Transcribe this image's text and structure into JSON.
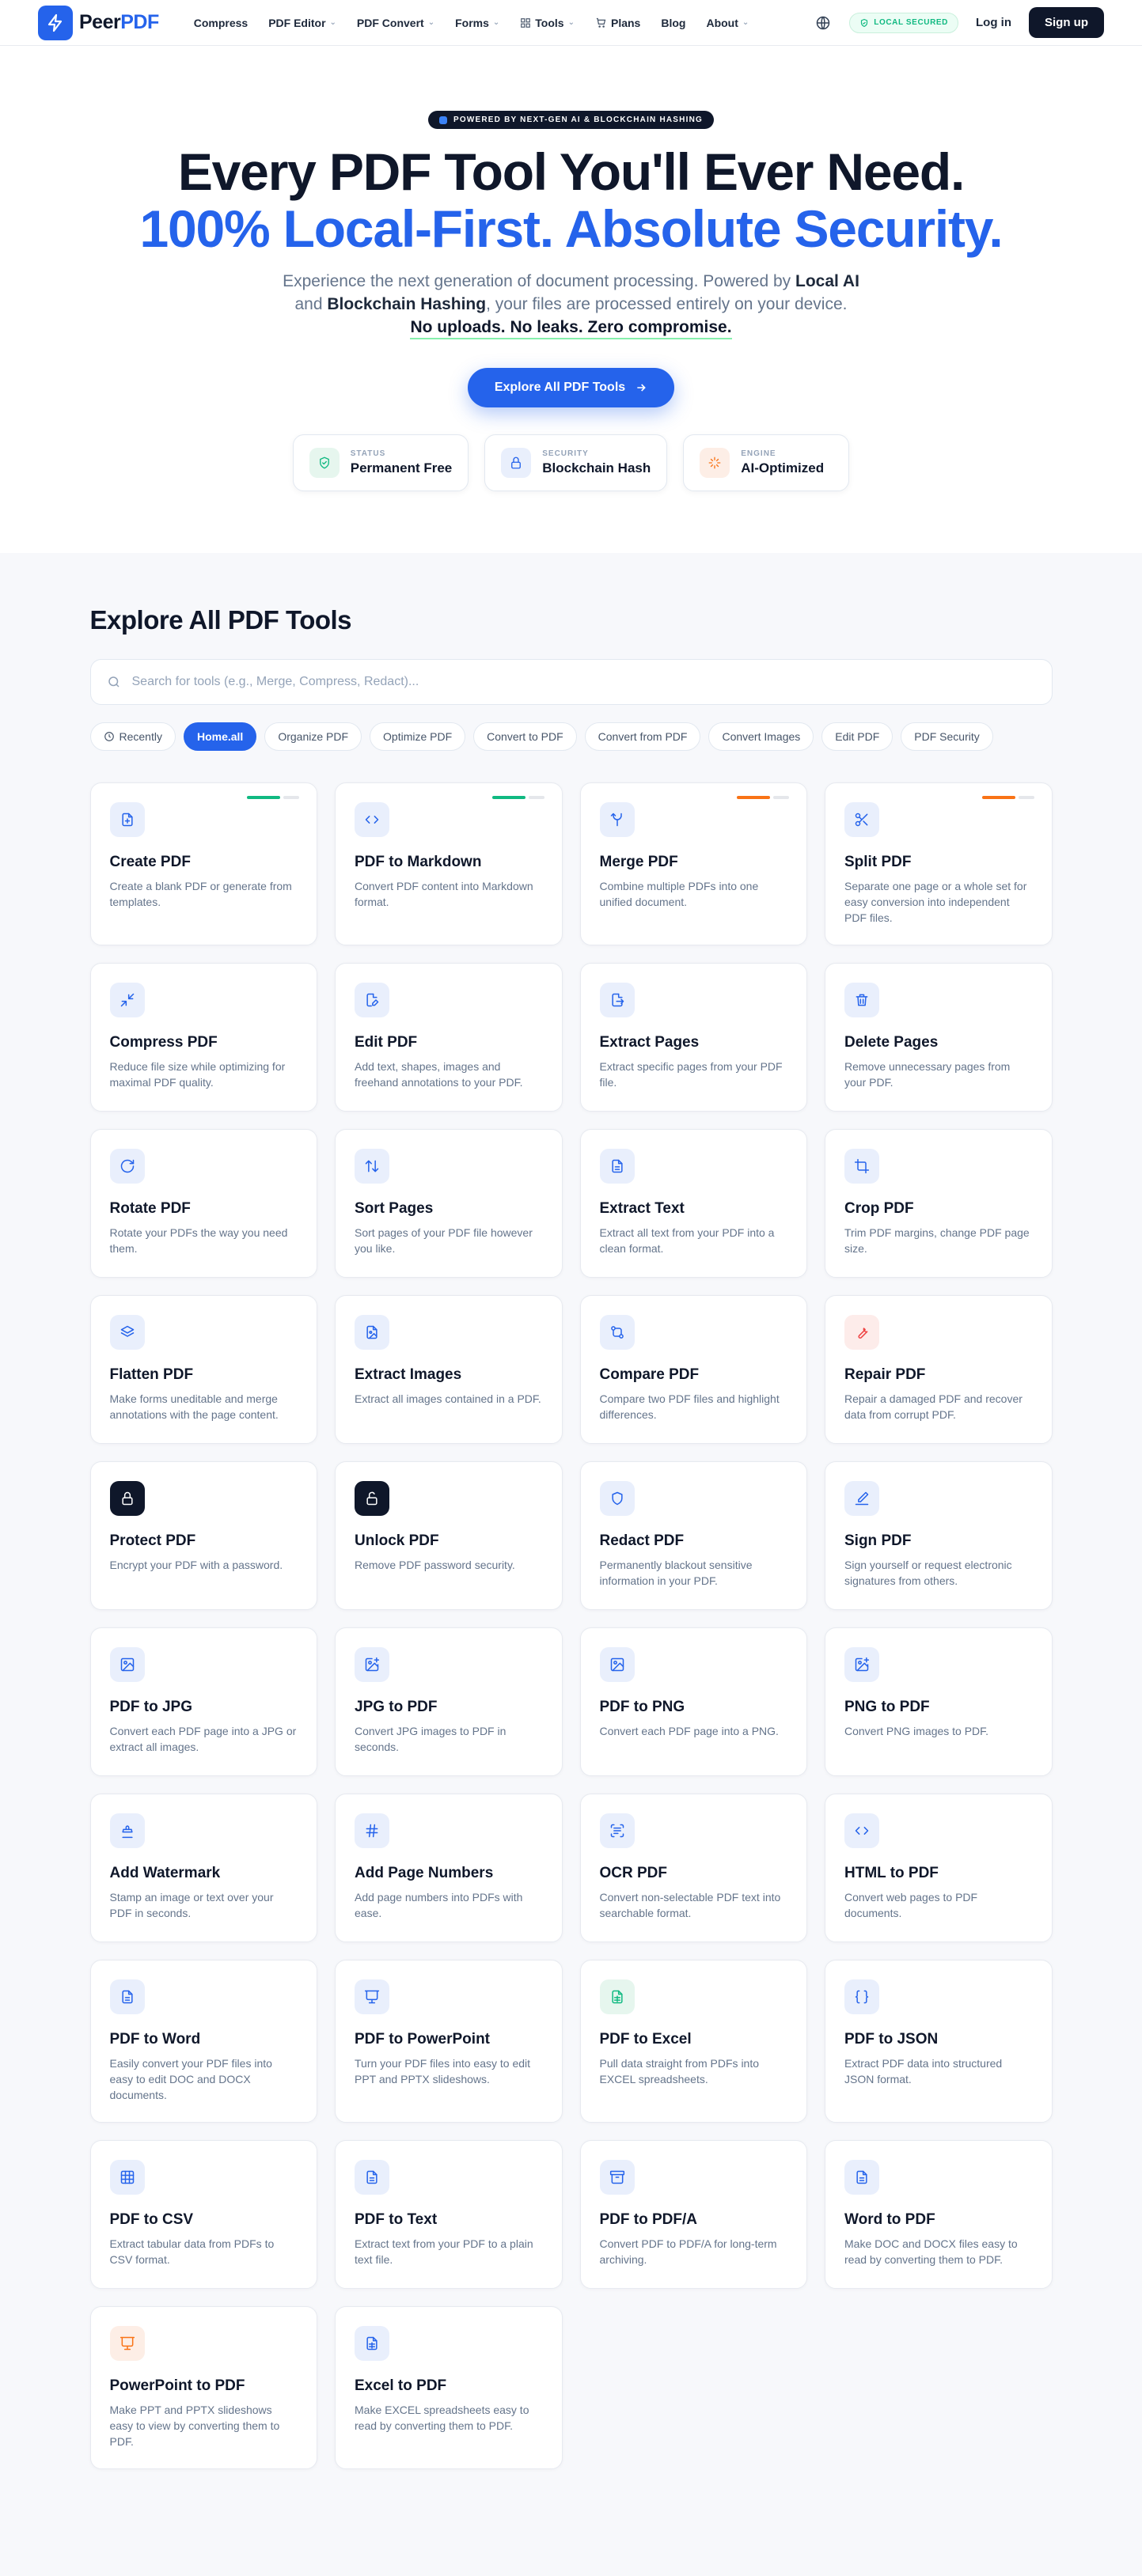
{
  "nav": {
    "brand_a": "Peer",
    "brand_b": "PDF",
    "links": [
      {
        "label": "Compress",
        "dropdown": false
      },
      {
        "label": "PDF Editor",
        "dropdown": true
      },
      {
        "label": "PDF Convert",
        "dropdown": true
      },
      {
        "label": "Forms",
        "dropdown": true
      },
      {
        "label": "Tools",
        "dropdown": true
      },
      {
        "label": "Plans",
        "dropdown": false
      },
      {
        "label": "Blog",
        "dropdown": false
      },
      {
        "label": "About",
        "dropdown": true
      }
    ],
    "local_badge": "LOCAL SECURED",
    "login": "Log in",
    "signup": "Sign up"
  },
  "hero": {
    "pill": "POWERED BY NEXT-GEN AI & BLOCKCHAIN HASHING",
    "title_line1": "Every PDF Tool You'll Ever Need.",
    "title_line2": "100% Local-First. Absolute Security.",
    "sub_a": "Experience the next generation of document processing. Powered by ",
    "sub_b": "Local AI",
    "sub_c": "and ",
    "sub_d": "Blockchain Hashing",
    "sub_e": ", your files are processed entirely on your device.",
    "sub_u": "No uploads. No leaks. Zero compromise.",
    "cta": "Explore All PDF Tools",
    "features": [
      {
        "label": "STATUS",
        "value": "Permanent Free",
        "icon": "shield-check-icon",
        "color": "#10b981",
        "bg": "#e6f6ee"
      },
      {
        "label": "SECURITY",
        "value": "Blockchain Hash",
        "icon": "lock-icon",
        "color": "#2563eb",
        "bg": "#e9effc"
      },
      {
        "label": "ENGINE",
        "value": "AI-Optimized",
        "icon": "sparkle-icon",
        "color": "#f97316",
        "bg": "#fdeee6"
      }
    ]
  },
  "tools": {
    "title": "Explore All PDF Tools",
    "search_placeholder": "Search for tools (e.g., Merge, Compress, Redact)...",
    "filters": [
      "Recently",
      "Home.all",
      "Organize PDF",
      "Optimize PDF",
      "Convert to PDF",
      "Convert from PDF",
      "Convert Images",
      "Edit PDF",
      "PDF Security"
    ],
    "active_filter": "Home.all",
    "cards": [
      {
        "title": "Create PDF",
        "desc": "Create a blank PDF or generate from templates.",
        "icon": "file-plus-icon",
        "mark": "green"
      },
      {
        "title": "PDF to Markdown",
        "desc": "Convert PDF content into Markdown format.",
        "icon": "code-icon",
        "mark": "green"
      },
      {
        "title": "Merge PDF",
        "desc": "Combine multiple PDFs into one unified document.",
        "icon": "merge-icon",
        "mark": "orange"
      },
      {
        "title": "Split PDF",
        "desc": "Separate one page or a whole set for easy conversion into independent PDF files.",
        "icon": "scissors-icon",
        "mark": "orange"
      },
      {
        "title": "Compress PDF",
        "desc": "Reduce file size while optimizing for maximal PDF quality.",
        "icon": "compress-icon"
      },
      {
        "title": "Edit PDF",
        "desc": "Add text, shapes, images and freehand annotations to your PDF.",
        "icon": "file-edit-icon"
      },
      {
        "title": "Extract Pages",
        "desc": "Extract specific pages from your PDF file.",
        "icon": "file-export-icon"
      },
      {
        "title": "Delete Pages",
        "desc": "Remove unnecessary pages from your PDF.",
        "icon": "trash-icon"
      },
      {
        "title": "Rotate PDF",
        "desc": "Rotate your PDFs the way you need them.",
        "icon": "rotate-icon"
      },
      {
        "title": "Sort Pages",
        "desc": "Sort pages of your PDF file however you like.",
        "icon": "sort-icon"
      },
      {
        "title": "Extract Text",
        "desc": "Extract all text from your PDF into a clean format.",
        "icon": "file-text-icon"
      },
      {
        "title": "Crop PDF",
        "desc": "Trim PDF margins, change PDF page size.",
        "icon": "crop-icon"
      },
      {
        "title": "Flatten PDF",
        "desc": "Make forms uneditable and merge annotations with the page content.",
        "icon": "layers-icon"
      },
      {
        "title": "Extract Images",
        "desc": "Extract all images contained in a PDF.",
        "icon": "file-image-icon"
      },
      {
        "title": "Compare PDF",
        "desc": "Compare two PDF files and highlight differences.",
        "icon": "compare-icon"
      },
      {
        "title": "Repair PDF",
        "desc": "Repair a damaged PDF and recover data from corrupt PDF.",
        "icon": "wrench-icon",
        "tone": "red"
      },
      {
        "title": "Protect PDF",
        "desc": "Encrypt your PDF with a password.",
        "icon": "lock-icon",
        "tone": "dark"
      },
      {
        "title": "Unlock PDF",
        "desc": "Remove PDF password security.",
        "icon": "unlock-icon",
        "tone": "dark"
      },
      {
        "title": "Redact PDF",
        "desc": "Permanently blackout sensitive information in your PDF.",
        "icon": "shield-icon"
      },
      {
        "title": "Sign PDF",
        "desc": "Sign yourself or request electronic signatures from others.",
        "icon": "signature-icon"
      },
      {
        "title": "PDF to JPG",
        "desc": "Convert each PDF page into a JPG or extract all images.",
        "icon": "image-icon"
      },
      {
        "title": "JPG to PDF",
        "desc": "Convert JPG images to PDF in seconds.",
        "icon": "image-plus-icon"
      },
      {
        "title": "PDF to PNG",
        "desc": "Convert each PDF page into a PNG.",
        "icon": "image-icon"
      },
      {
        "title": "PNG to PDF",
        "desc": "Convert PNG images to PDF.",
        "icon": "image-plus-icon"
      },
      {
        "title": "Add Watermark",
        "desc": "Stamp an image or text over your PDF in seconds.",
        "icon": "stamp-icon"
      },
      {
        "title": "Add Page Numbers",
        "desc": "Add page numbers into PDFs with ease.",
        "icon": "hash-icon"
      },
      {
        "title": "OCR PDF",
        "desc": "Convert non-selectable PDF text into searchable format.",
        "icon": "scan-text-icon"
      },
      {
        "title": "HTML to PDF",
        "desc": "Convert web pages to PDF documents.",
        "icon": "code-icon"
      },
      {
        "title": "PDF to Word",
        "desc": "Easily convert your PDF files into easy to edit DOC and DOCX documents.",
        "icon": "file-text-icon"
      },
      {
        "title": "PDF to PowerPoint",
        "desc": "Turn your PDF files into easy to edit PPT and PPTX slideshows.",
        "icon": "presentation-icon"
      },
      {
        "title": "PDF to Excel",
        "desc": "Pull data straight from PDFs into EXCEL spreadsheets.",
        "icon": "file-spreadsheet-icon",
        "tone": "green"
      },
      {
        "title": "PDF to JSON",
        "desc": "Extract PDF data into structured JSON format.",
        "icon": "braces-icon"
      },
      {
        "title": "PDF to CSV",
        "desc": "Extract tabular data from PDFs to CSV format.",
        "icon": "table-icon"
      },
      {
        "title": "PDF to Text",
        "desc": "Extract text from your PDF to a plain text file.",
        "icon": "file-text-icon"
      },
      {
        "title": "PDF to PDF/A",
        "desc": "Convert PDF to PDF/A for long-term archiving.",
        "icon": "archive-icon"
      },
      {
        "title": "Word to PDF",
        "desc": "Make DOC and DOCX files easy to read by converting them to PDF.",
        "icon": "file-text-icon"
      },
      {
        "title": "PowerPoint to PDF",
        "desc": "Make PPT and PPTX slideshows easy to view by converting them to PDF.",
        "icon": "presentation-icon",
        "tone": "orange"
      },
      {
        "title": "Excel to PDF",
        "desc": "Make EXCEL spreadsheets easy to read by converting them to PDF.",
        "icon": "file-spreadsheet-icon"
      }
    ]
  },
  "colors": {
    "accent": "#2563eb",
    "dark": "#0f172a",
    "success": "#10b981",
    "warning": "#f97316"
  }
}
